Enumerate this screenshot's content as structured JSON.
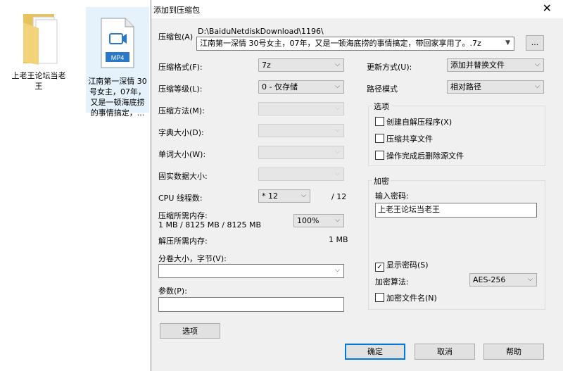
{
  "desktop": {
    "folder_label": "上老王论坛当老\n王",
    "video_badge": "MP4",
    "video_label": "江南第一深情 30\n号女主，07年，\n又是一顿海底捞\n的事情搞定，..."
  },
  "dialog": {
    "title": "添加到压缩包",
    "archive_label": "压缩包(A)",
    "archive_path": "D:\\BaiduNetdiskDownload\\1196\\",
    "archive_name": "江南第一深情 30号女主，07年，又是一顿海底捞的事情搞定，带回家享用了。.7z",
    "browse_label": "...",
    "format_label": "压缩格式(F):",
    "format_value": "7z",
    "level_label": "压缩等级(L):",
    "level_value": "0 - 仅存储",
    "method_label": "压缩方法(M):",
    "dict_label": "字典大小(D):",
    "word_label": "单词大小(W):",
    "solid_label": "固实数据大小:",
    "cpu_label": "CPU 线程数:",
    "cpu_value": "* 12",
    "cpu_total": "/ 12",
    "mem_comp_label": "压缩所需内存:",
    "mem_comp_value": "1 MB / 8125 MB / 8125 MB",
    "mem_percent": "100%",
    "mem_decomp_label": "解压所需内存:",
    "mem_decomp_value": "1 MB",
    "split_label": "分卷大小，字节(V):",
    "split_value": "",
    "params_label": "参数(P):",
    "params_value": "",
    "options_button": "选项",
    "update_label": "更新方式(U):",
    "update_value": "添加并替换文件",
    "pathmode_label": "路径模式",
    "pathmode_value": "相对路径",
    "options_group": "选项",
    "opt_sfx": "创建自解压程序(X)",
    "opt_shared": "压缩共享文件",
    "opt_delete": "操作完成后删除源文件",
    "encrypt_group": "加密",
    "password_label": "输入密码:",
    "password_value": "上老王论坛当老王",
    "show_password": "显示密码(S)",
    "show_password_checked": true,
    "enc_method_label": "加密算法:",
    "enc_method_value": "AES-256",
    "enc_names": "加密文件名(N)",
    "ok": "确定",
    "cancel": "取消",
    "help": "帮助"
  }
}
